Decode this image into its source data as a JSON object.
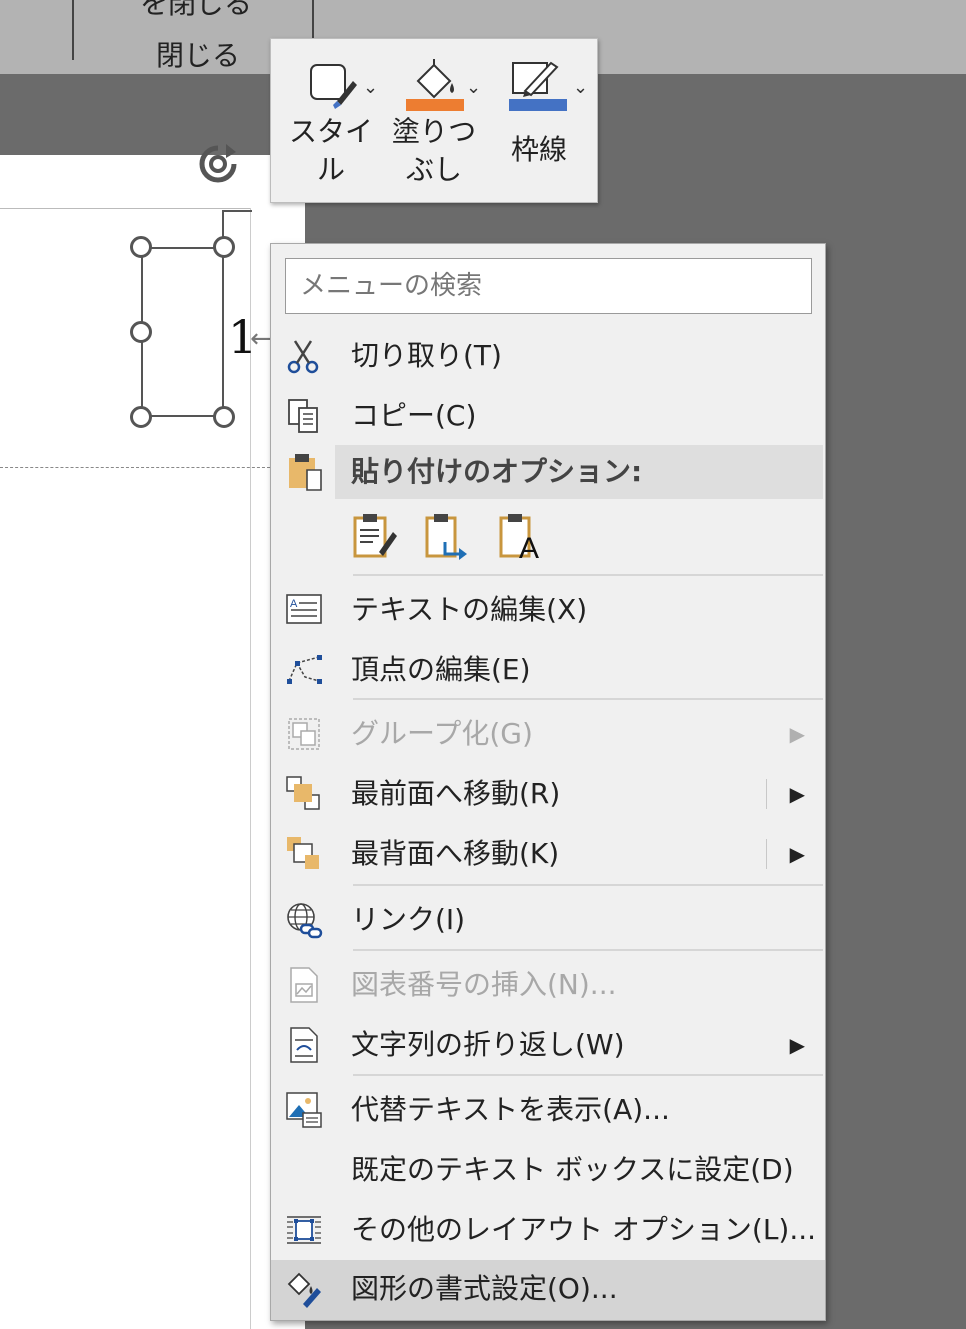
{
  "ribbon": {
    "top_partial_label": "を閉じる",
    "close_label": "閉じる"
  },
  "document": {
    "shape_text": "1"
  },
  "mini_toolbar": {
    "style_label": "スタイ\nル",
    "style_label_lines": [
      "スタイ",
      "ル"
    ],
    "fill_label_lines": [
      "塗りつ",
      "ぶし"
    ],
    "outline_label": "枠線",
    "fill_color": "#ed7d31",
    "outline_color": "#4472c4"
  },
  "context_menu": {
    "search_placeholder": "メニューの検索",
    "items": {
      "cut": "切り取り(T)",
      "copy": "コピー(C)",
      "paste_options": "貼り付けのオプション:",
      "edit_text": "テキストの編集(X)",
      "edit_points": "頂点の編集(E)",
      "group": "グループ化(G)",
      "bring_front": "最前面へ移動(R)",
      "send_back": "最背面へ移動(K)",
      "link": "リンク(I)",
      "insert_caption": "図表番号の挿入(N)...",
      "wrap_text": "文字列の折り返し(W)",
      "alt_text": "代替テキストを表示(A)...",
      "set_default": "既定のテキスト ボックスに設定(D)",
      "more_layout": "その他のレイアウト オプション(L)...",
      "format_shape": "図形の書式設定(O)..."
    },
    "paste_option_keep_source_letter": "A"
  },
  "colors": {
    "accent_orange": "#ed7d31",
    "accent_blue": "#4472c4",
    "clipboard_tan": "#e8b86a"
  }
}
